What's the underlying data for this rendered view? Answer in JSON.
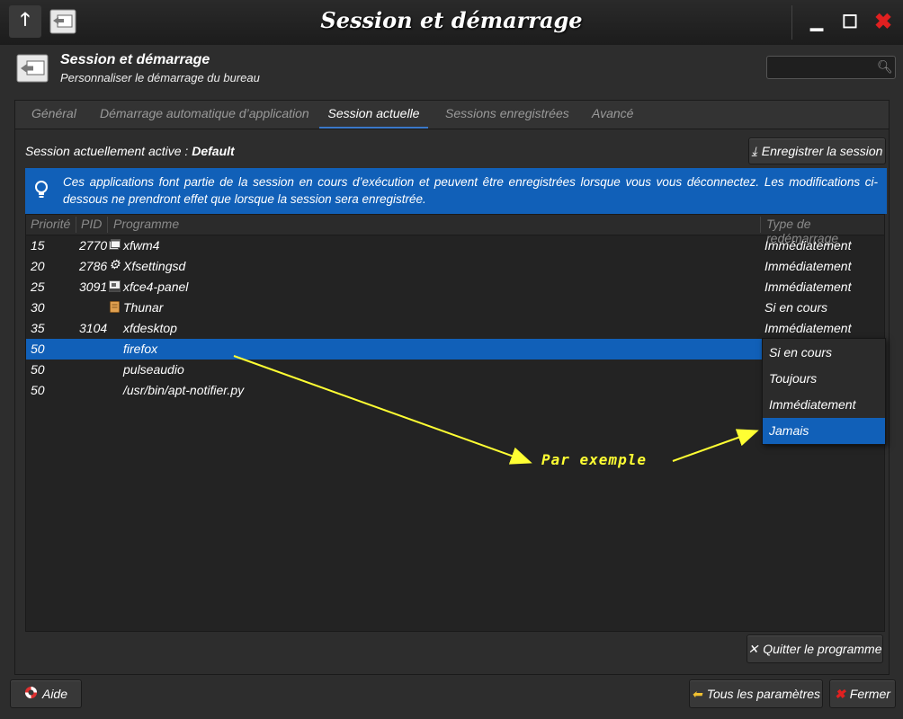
{
  "window": {
    "title": "Session et démarrage",
    "icons": [
      "up-arrow-icon",
      "session-app-icon",
      "minimize-icon",
      "maximize-icon",
      "close-icon"
    ]
  },
  "header": {
    "title": "Session et démarrage",
    "subtitle": "Personnaliser le démarrage du bureau",
    "search_value": ""
  },
  "tabs": [
    {
      "label": "Général",
      "active": false
    },
    {
      "label": "Démarrage automatique d’application",
      "active": false
    },
    {
      "label": "Session actuelle",
      "active": true
    },
    {
      "label": "Sessions enregistrées",
      "active": false
    },
    {
      "label": "Avancé",
      "active": false
    }
  ],
  "current_session": {
    "label": "Session actuellement active : ",
    "name": "Default",
    "save_button": "Enregistrer la session"
  },
  "info_message": "Ces applications font partie de la session en cours d’exécution et peuvent être enregistrées lorsque vous vous déconnectez. Les modifications ci-dessous ne prendront effet que lorsque la session sera enregistrée.",
  "table": {
    "columns": [
      "Priorité",
      "PID",
      "Programme",
      "Type de redémarrage"
    ],
    "rows": [
      {
        "priority": "15",
        "pid": "2770",
        "icon": "window-icon",
        "program": "xfwm4",
        "restart": "Immédiatement",
        "selected": false
      },
      {
        "priority": "20",
        "pid": "2786",
        "icon": "gear-icon",
        "program": "Xfsettingsd",
        "restart": "Immédiatement",
        "selected": false
      },
      {
        "priority": "25",
        "pid": "3091",
        "icon": "panel-icon",
        "program": "xfce4-panel",
        "restart": "Immédiatement",
        "selected": false
      },
      {
        "priority": "30",
        "pid": "",
        "icon": "file-manager-icon",
        "program": "Thunar",
        "restart": "Si en cours",
        "selected": false
      },
      {
        "priority": "35",
        "pid": "3104",
        "icon": "",
        "program": "xfdesktop",
        "restart": "Immédiatement",
        "selected": false
      },
      {
        "priority": "50",
        "pid": "",
        "icon": "",
        "program": "firefox",
        "restart": "",
        "selected": true
      },
      {
        "priority": "50",
        "pid": "",
        "icon": "",
        "program": "pulseaudio",
        "restart": "",
        "selected": false
      },
      {
        "priority": "50",
        "pid": "",
        "icon": "",
        "program": "/usr/bin/apt-notifier.py",
        "restart": "",
        "selected": false
      }
    ]
  },
  "restart_dropdown": {
    "options": [
      "Si en cours",
      "Toujours",
      "Immédiatement",
      "Jamais"
    ],
    "highlighted": "Jamais"
  },
  "annotation": "Par exemple",
  "annotation_color": "#ffff33",
  "quit_button": "Quitter le programme",
  "footer": {
    "help": "Aide",
    "all_settings": "Tous les paramètres",
    "close": "Fermer"
  },
  "colors": {
    "accent": "#1160b8",
    "background": "#2d2d2d",
    "close_red": "#e02020"
  }
}
